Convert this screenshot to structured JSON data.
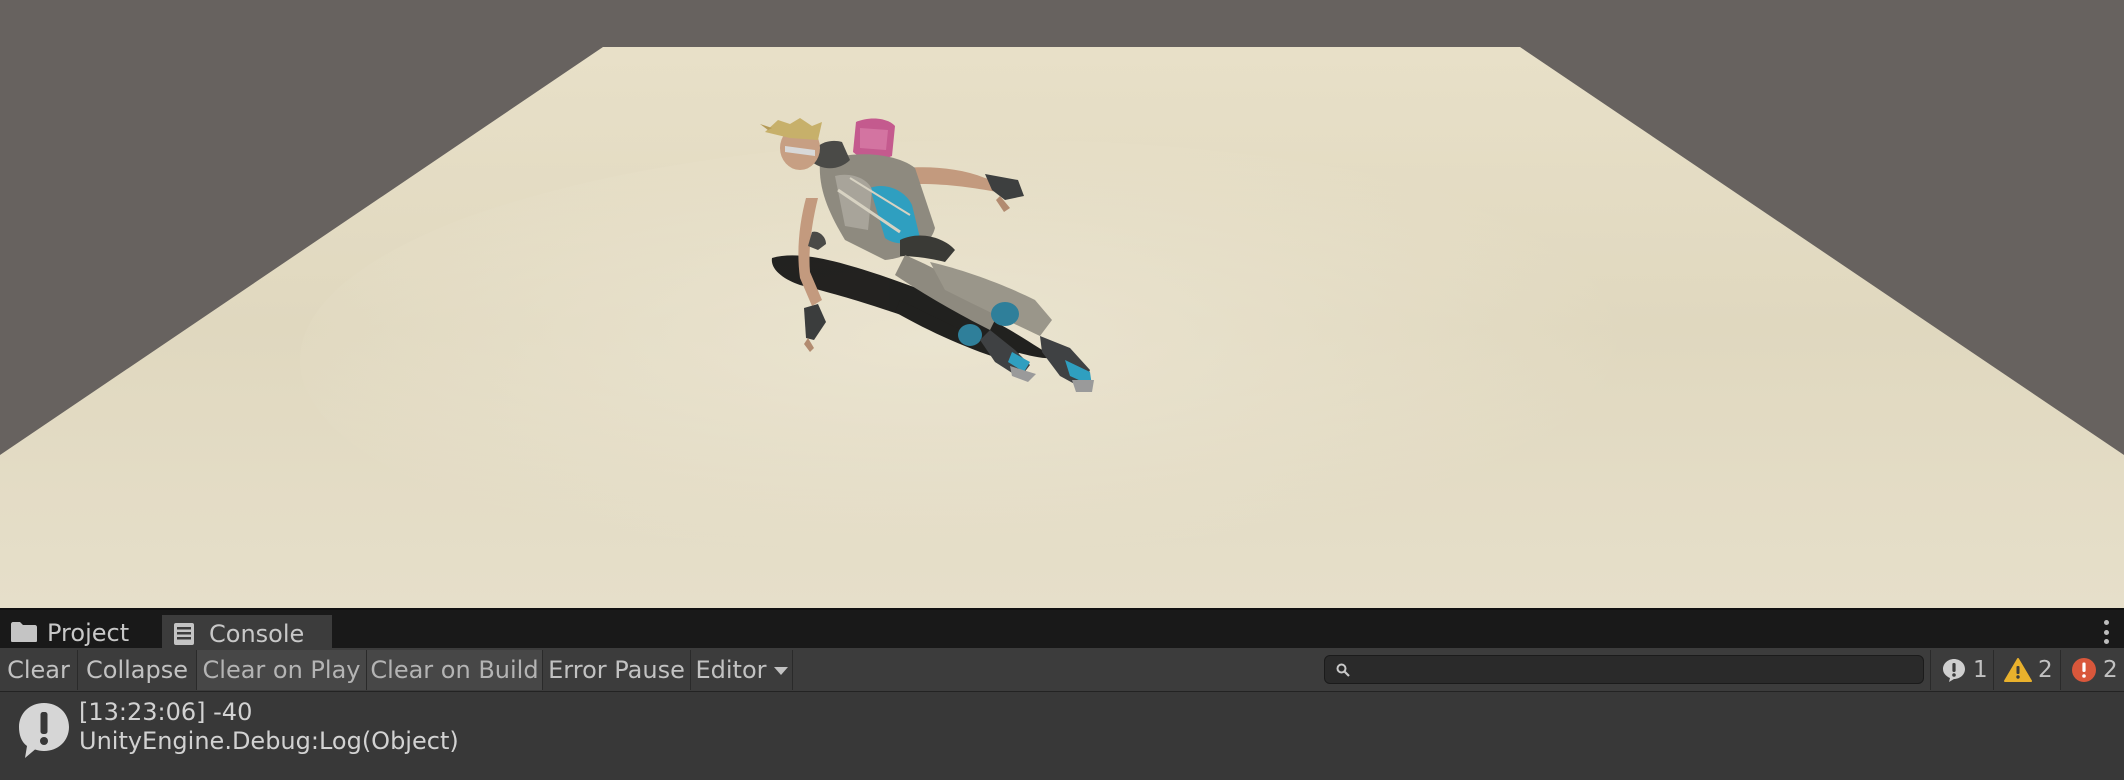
{
  "tabs": {
    "project_label": "Project",
    "console_label": "Console"
  },
  "toolbar": {
    "clear_label": "Clear",
    "collapse_label": "Collapse",
    "clear_on_play_label": "Clear on Play",
    "clear_on_build_label": "Clear on Build",
    "error_pause_label": "Error Pause",
    "editor_label": "Editor",
    "search_placeholder": "",
    "search_value": ""
  },
  "counters": {
    "log_count": "1",
    "warning_count": "2",
    "error_count": "2"
  },
  "log_entries": [
    {
      "time_and_message": "[13:23:06] -40",
      "source": "UnityEngine.Debug:Log(Object)",
      "icon": "info-icon"
    }
  ],
  "colors": {
    "scene_background": "#67625f",
    "ground_plane": "#e2dac3",
    "panel_background": "#383838",
    "warning": "#e9b12c",
    "error": "#d9573b"
  }
}
